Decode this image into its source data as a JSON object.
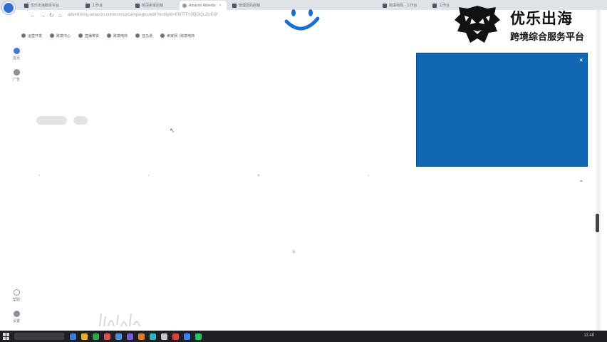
{
  "browser": {
    "tabs": [
      {
        "label": "优乐出海服务平台",
        "active": false
      },
      {
        "label": "工作台",
        "active": false
      },
      {
        "label": "跨境卖家店铺",
        "active": false
      },
      {
        "label": "Amazon Advertis",
        "active": true
      },
      {
        "label": "管理您的店铺",
        "active": false
      },
      {
        "label": "跨境电商 · 工作台",
        "active": false
      },
      {
        "label": "工作台",
        "active": false
      }
    ],
    "url": "advertising.amazon.com/cm/sp/campaigns/edit?entityId=ENTITY3QOQL2UEW",
    "bookmarks": [
      "运营开发",
      "跨境中心",
      "直播带货",
      "跨境电商",
      "亚马逊",
      "卖家网 | 跨境电商"
    ]
  },
  "rail": {
    "items": [
      {
        "label": "首页",
        "icon": "home-icon"
      },
      {
        "label": "广告",
        "icon": "ads-icon"
      }
    ],
    "bottom": [
      {
        "label": "帮助",
        "icon": "help-icon"
      },
      {
        "label": "设置",
        "icon": "settings-icon"
      }
    ]
  },
  "content": {
    "pills": [
      "",
      ""
    ],
    "chevrons": [
      "⌄",
      "⌄",
      "▸",
      "⌄"
    ],
    "faint_left": "",
    "faint_center": ""
  },
  "brand": {
    "title": "优乐出海",
    "subtitle": "跨境综合服务平台",
    "color": "#111111"
  },
  "popup": {
    "color": "#1167b1",
    "close_label": "×"
  },
  "taskbar": {
    "search_placeholder": "",
    "tray": "11:48"
  },
  "colors": {
    "accent_blue": "#1167b1",
    "smiley_blue": "#1a6fd3"
  }
}
